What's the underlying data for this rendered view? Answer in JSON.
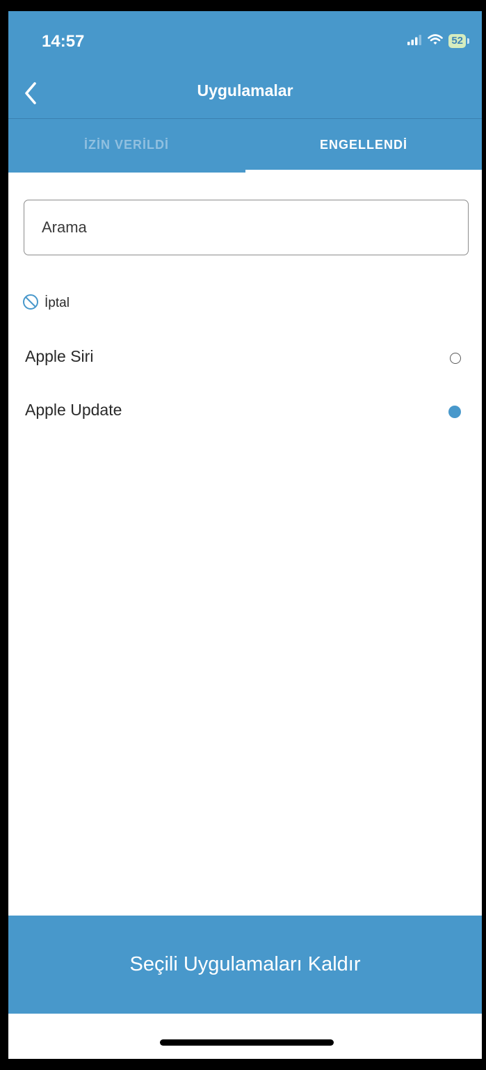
{
  "status_bar": {
    "time": "14:57",
    "battery": "52",
    "signal_icon": "signal-bars-icon",
    "wifi_icon": "wifi-icon"
  },
  "header": {
    "title": "Uygulamalar",
    "back_icon": "chevron-left-icon"
  },
  "tabs": [
    {
      "label": "İZİN VERİLDİ",
      "active": false
    },
    {
      "label": "ENGELLENDİ",
      "active": true
    }
  ],
  "search": {
    "placeholder": "Arama",
    "value": ""
  },
  "cancel": {
    "label": "İptal",
    "icon": "prohibited-icon"
  },
  "apps": [
    {
      "name": "Apple Siri",
      "selected": false
    },
    {
      "name": "Apple Update",
      "selected": true
    }
  ],
  "footer": {
    "remove_label": "Seçili Uygulamaları Kaldır"
  },
  "colors": {
    "primary": "#4898cb",
    "inactive_tab": "#91c0e0",
    "text": "#2a2a2a"
  }
}
